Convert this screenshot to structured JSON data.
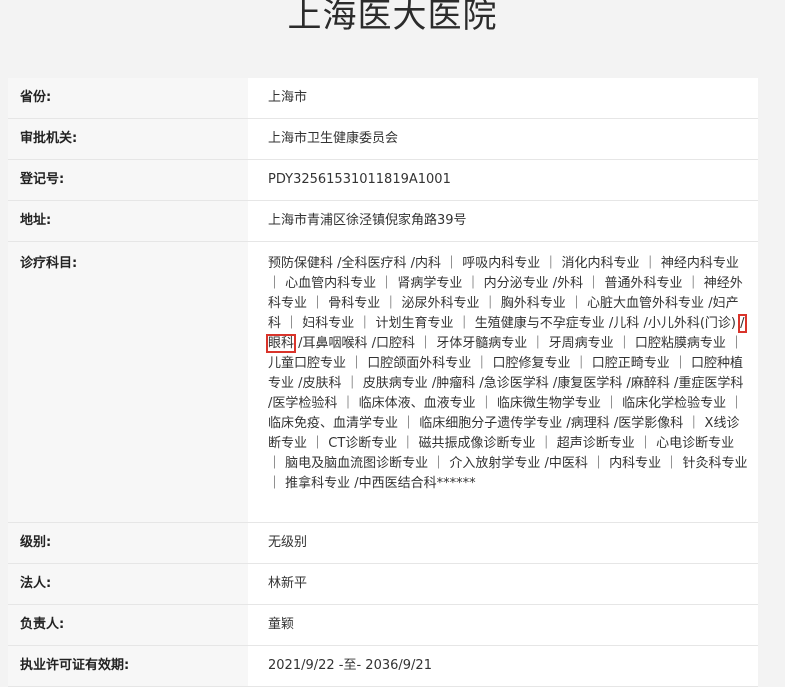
{
  "page": {
    "title": "上海医大医院"
  },
  "rows": {
    "province": {
      "label": "省份:",
      "value": "上海市"
    },
    "authority": {
      "label": "审批机关:",
      "value": "上海市卫生健康委员会"
    },
    "reg_no": {
      "label": "登记号:",
      "value": "PDY32561531011819A1001"
    },
    "address": {
      "label": "地址:",
      "value": "上海市青浦区徐泾镇倪家角路39号"
    },
    "scope": {
      "label": "诊疗科目:",
      "before": "预防保健科 /全科医疗科 /内科 ｜ 呼吸内科专业 ｜ 消化内科专业 ｜ 神经内科专业 ｜ 心血管内科专业 ｜ 肾病学专业 ｜ 内分泌专业 /外科 ｜ 普通外科专业 ｜ 神经外科专业 ｜ 骨科专业 ｜ 泌尿外科专业 ｜ 胸外科专业 ｜ 心脏大血管外科专业 /妇产科 ｜ 妇科专业 ｜ 计划生育专业 ｜ 生殖健康与不孕症专业 /儿科 /小儿外科(门诊) ",
      "highlight": "/眼科",
      "after": " /耳鼻咽喉科 /口腔科 ｜ 牙体牙髓病专业 ｜ 牙周病专业 ｜ 口腔粘膜病专业 ｜ 儿童口腔专业 ｜ 口腔颌面外科专业 ｜ 口腔修复专业 ｜ 口腔正畸专业 ｜ 口腔种植专业 /皮肤科 ｜ 皮肤病专业 /肿瘤科 /急诊医学科 /康复医学科 /麻醉科 /重症医学科 /医学检验科 ｜ 临床体液、血液专业 ｜ 临床微生物学专业 ｜ 临床化学检验专业 ｜ 临床免疫、血清学专业 ｜ 临床细胞分子遗传学专业 /病理科 /医学影像科 ｜ X线诊断专业 ｜ CT诊断专业 ｜ 磁共振成像诊断专业 ｜ 超声诊断专业 ｜ 心电诊断专业 ｜ 脑电及脑血流图诊断专业 ｜ 介入放射学专业 /中医科 ｜ 内科专业 ｜ 针灸科专业 ｜ 推拿科专业 /中西医结合科******"
    },
    "level": {
      "label": "级别:",
      "value": "无级别"
    },
    "legal_person": {
      "label": "法人:",
      "value": "林新平"
    },
    "principal": {
      "label": "负责人:",
      "value": "童颖"
    },
    "validity": {
      "label": "执业许可证有效期:",
      "value": "2021/9/22 -至- 2036/9/21"
    }
  },
  "colors": {
    "highlight_box": "#d9342b",
    "label_bg": "#f7f7f7",
    "page_bg": "#f3f3f3"
  }
}
